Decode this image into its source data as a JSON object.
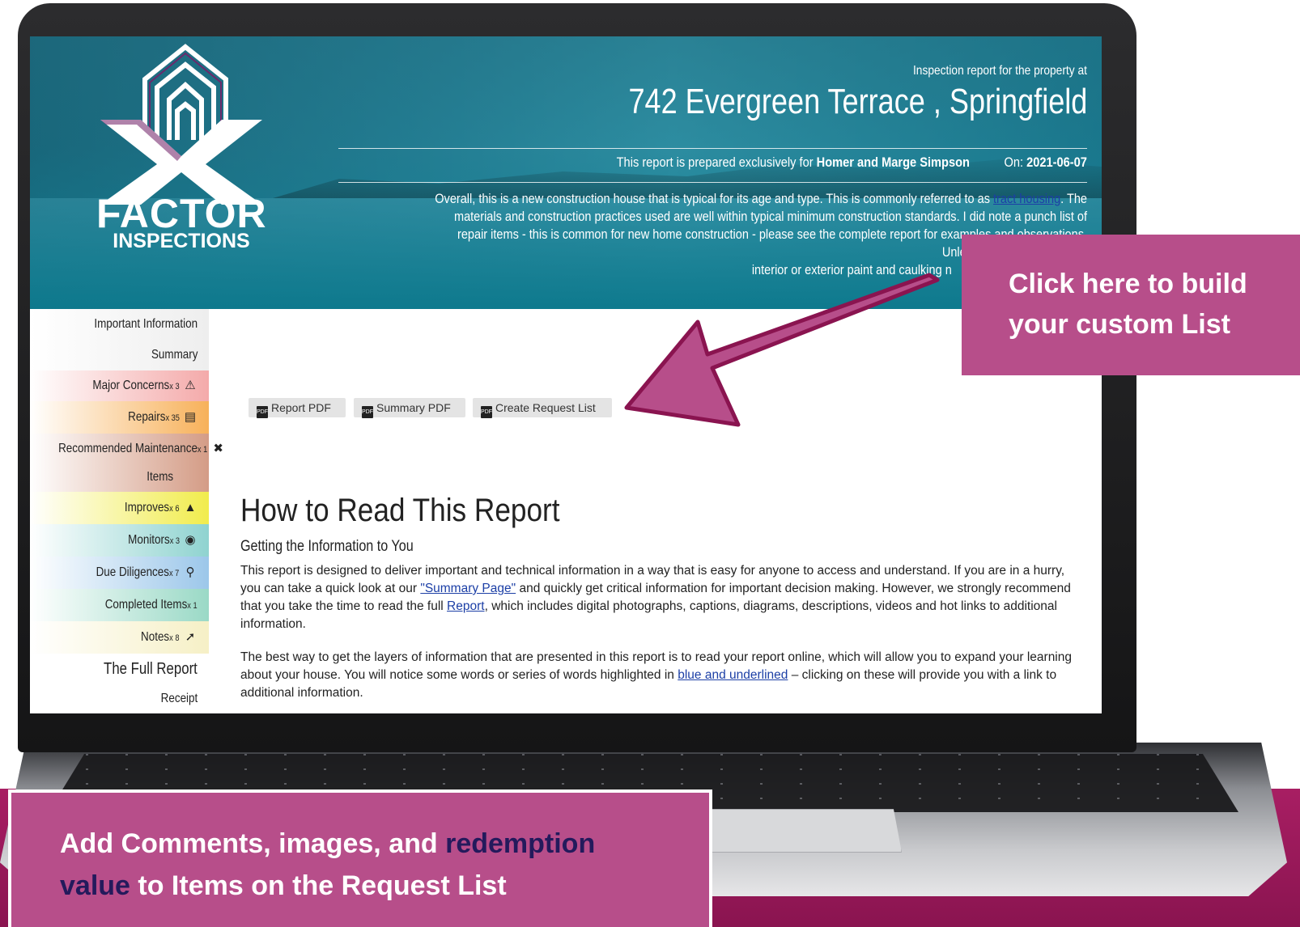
{
  "header": {
    "pre_title": "Inspection report for the property at",
    "address": "742 Evergreen Terrace , Springfield",
    "prepared_prefix": "This report is prepared exclusively for",
    "client": "Homer and Marge Simpson",
    "date_prefix": "On:",
    "date": "2021-06-07",
    "summary_before_link": "Overall, this is a new construction house that is typical for its age and type. This is commonly referred to as",
    "summary_link": "tract housing",
    "summary_after_link": ". The materials and construction practices used are well within typical minimum construction standards. I did note a punch list of repair items - this is common for new home construction - please see the complete report for examples and observations. Unless crucial, I made no m",
    "summary_line4": "interior or exterior paint and caulking n"
  },
  "logo": {
    "line1": "FACTOR",
    "line2": "INSPECTIONS"
  },
  "sidebar": {
    "items": [
      {
        "label": "Important Information",
        "count": "",
        "icon": "",
        "color": "#f4f4f4"
      },
      {
        "label": "Summary",
        "count": "",
        "icon": "",
        "color": "#f4f4f4"
      },
      {
        "label": "Major Concerns",
        "count": "x 3",
        "icon": "warning-triangle-icon",
        "color": "#f4aaaa"
      },
      {
        "label": "Repairs",
        "count": "x 35",
        "icon": "paint-roller-icon",
        "color": "#f7b15a"
      },
      {
        "label": "Recommended Maintenance",
        "count": "x 1",
        "icon": "tools-icon",
        "color": "#d49c86",
        "label2": "Items"
      },
      {
        "label": "Improves",
        "count": "x 6",
        "icon": "chart-up-icon",
        "color": "#f1ec4c"
      },
      {
        "label": "Monitors",
        "count": "x 3",
        "icon": "eye-icon",
        "color": "#8fd3d0"
      },
      {
        "label": "Due Diligences",
        "count": "x 7",
        "icon": "search-icon",
        "color": "#9cc7ea"
      },
      {
        "label": "Completed Items",
        "count": "x 1",
        "icon": "",
        "color": "#9ad9c6"
      },
      {
        "label": "Notes",
        "count": "x 8",
        "icon": "pin-icon",
        "color": "#f6f0c6"
      },
      {
        "label": "The Full Report",
        "count": "",
        "icon": "",
        "color": "#ffffff"
      },
      {
        "label": "Receipt",
        "count": "",
        "icon": "",
        "color": "#ffffff"
      }
    ]
  },
  "buttons": {
    "report_pdf": "Report PDF",
    "summary_pdf": "Summary PDF",
    "create_request_list": "Create Request List",
    "pdf_icon_text": "PDF"
  },
  "content": {
    "title": "How to Read This Report",
    "subtitle": "Getting the Information to You",
    "p1_a": "This report is designed to deliver important and technical information in a way that is easy for anyone to access and understand. If you are in a hurry, you can take a quick look at our ",
    "p1_link1": "\"Summary Page\"",
    "p1_b": " and quickly get critical information for important decision making. However, we strongly recommend that you take the time to read the full ",
    "p1_link2": "Report",
    "p1_c": ", which includes digital photographs, captions, diagrams, descriptions, videos and hot links to additional information.",
    "p2_a": "The best way to get the layers of information that are presented in this report is to read your report online, which will allow you to expand your learning about your house. You will notice some words or series of words highlighted in ",
    "p2_link": "blue and underlined",
    "p2_b": " – clicking on these will provide you with a link to additional information."
  },
  "callouts": {
    "right_line1": "Click here to build",
    "right_line2": "your custom List",
    "bottom_a": "Add Comments, images, and ",
    "bottom_highlight1": "redemption",
    "bottom_highlight2": "value",
    "bottom_b": " to Items on the Request List"
  },
  "colors": {
    "callout": "#b74e8a",
    "arrow": "#b74e8a",
    "arrow_stroke": "#8a1450",
    "highlight_text": "#241a5c",
    "link": "#1c3fa6"
  }
}
